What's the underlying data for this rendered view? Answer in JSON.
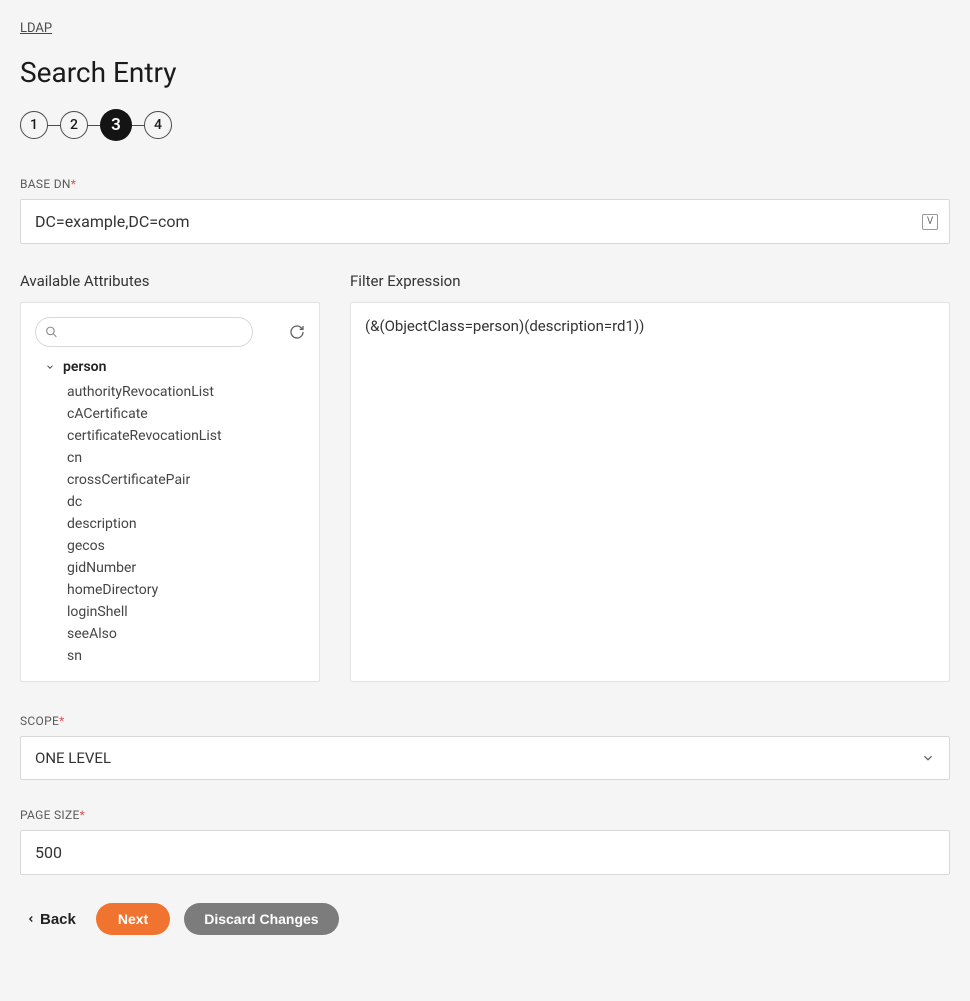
{
  "breadcrumb": "LDAP",
  "page_title": "Search Entry",
  "stepper": {
    "steps": [
      "1",
      "2",
      "3",
      "4"
    ],
    "current_index": 2
  },
  "base_dn": {
    "label": "BASE DN",
    "required": true,
    "value": "DC=example,DC=com",
    "suffix_icon": "V"
  },
  "attributes": {
    "label": "Available Attributes",
    "search_placeholder": "",
    "tree": {
      "root": "person",
      "children": [
        "authorityRevocationList",
        "cACertificate",
        "certificateRevocationList",
        "cn",
        "crossCertificatePair",
        "dc",
        "description",
        "gecos",
        "gidNumber",
        "homeDirectory",
        "loginShell",
        "seeAlso",
        "sn"
      ]
    }
  },
  "filter": {
    "label": "Filter Expression",
    "value": "(&(ObjectClass=person)(description=rd1))"
  },
  "scope": {
    "label": "SCOPE",
    "required": true,
    "selected": "ONE LEVEL"
  },
  "page_size": {
    "label": "PAGE SIZE",
    "required": true,
    "value": "500"
  },
  "buttons": {
    "back": "Back",
    "next": "Next",
    "discard": "Discard Changes"
  }
}
